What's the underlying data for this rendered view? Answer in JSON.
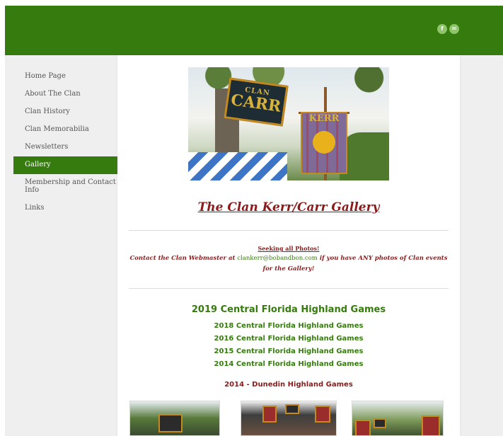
{
  "header": {
    "social": [
      {
        "label": "f",
        "icon": "facebook-icon"
      },
      {
        "label": "✉",
        "icon": "email-icon"
      }
    ]
  },
  "nav": {
    "items": [
      {
        "label": "Home Page",
        "active": false
      },
      {
        "label": "About The Clan",
        "active": false
      },
      {
        "label": "Clan History",
        "active": false
      },
      {
        "label": "Clan Memorabilia",
        "active": false
      },
      {
        "label": "Newsletters",
        "active": false
      },
      {
        "label": "Gallery",
        "active": true
      },
      {
        "label": "Membership and Contact Info",
        "active": false
      },
      {
        "label": "Links",
        "active": false
      }
    ]
  },
  "hero": {
    "banner_top": "CLAN",
    "banner_main": "CARR",
    "banner_kerr": "KERR"
  },
  "main": {
    "title": "The Clan Kerr/Carr Gallery",
    "seeking": "Seeking all Photos!",
    "contact_prefix": "Contact the Clan Webmaster at ",
    "contact_email": "clankerr@bobandbon.com",
    "contact_suffix": " if you have ANY photos of Clan events for the Gallery!",
    "featured_game": "2019 Central Florida Highland Games",
    "game_links": [
      "2018 Central Florida Highland Games",
      "2016 Central Florida Highland Games",
      "2015 Central Florida Highland Games",
      "2014 Central Florida Highland Games"
    ],
    "section_heading": "2014 - Dunedin Highland Games"
  },
  "colors": {
    "brand_green": "#367b0e",
    "title_red": "#8b1a1a",
    "sidebar_bg": "#efefef"
  }
}
